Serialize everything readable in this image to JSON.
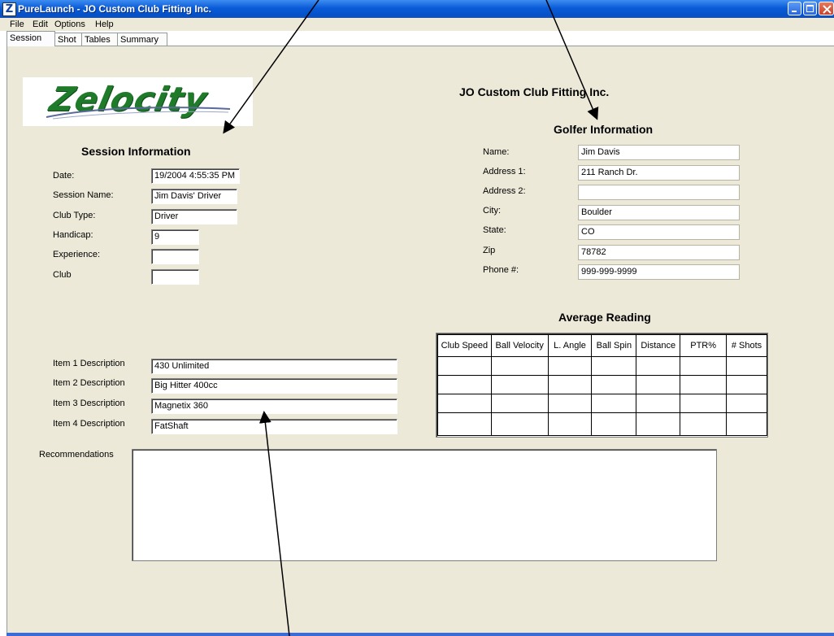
{
  "window": {
    "title": "PureLaunch - JO Custom Club Fitting Inc.",
    "icon_letter": "Z"
  },
  "menu": [
    "File",
    "Edit",
    "Options",
    "Help"
  ],
  "tabs": [
    "Session",
    "Shot",
    "Tables",
    "Summary"
  ],
  "active_tab": "Session",
  "logo_text": "Zelocity",
  "company": "JO Custom Club Fitting Inc.",
  "session": {
    "heading": "Session Information",
    "fields": [
      {
        "label": "Date:",
        "value": "19/2004 4:55:35 PM"
      },
      {
        "label": "Session Name:",
        "value": "Jim Davis' Driver"
      },
      {
        "label": "Club Type:",
        "value": "Driver"
      },
      {
        "label": "Handicap:",
        "value": "9"
      },
      {
        "label": "Experience:",
        "value": ""
      },
      {
        "label": "Club",
        "value": ""
      }
    ]
  },
  "golfer": {
    "heading": "Golfer Information",
    "fields": [
      {
        "label": "Name:",
        "value": "Jim Davis"
      },
      {
        "label": "Address 1:",
        "value": "211 Ranch Dr."
      },
      {
        "label": "Address 2:",
        "value": ""
      },
      {
        "label": "City:",
        "value": "Boulder"
      },
      {
        "label": "State:",
        "value": "CO"
      },
      {
        "label": "Zip",
        "value": "78782"
      },
      {
        "label": "Phone #:",
        "value": "999-999-9999"
      }
    ]
  },
  "average": {
    "heading": "Average Reading",
    "columns": [
      "Club Speed",
      "Ball Velocity",
      "L. Angle",
      "Ball Spin",
      "Distance",
      "PTR%",
      "# Shots"
    ],
    "rows": 4
  },
  "items": [
    {
      "label": "Item 1 Description",
      "value": "430 Unlimited"
    },
    {
      "label": "Item 2 Description",
      "value": "Big Hitter 400cc"
    },
    {
      "label": "Item 3 Description",
      "value": "Magnetix 360"
    },
    {
      "label": "Item 4 Description",
      "value": "FatShaft"
    }
  ],
  "recommendations": {
    "label": "Recommendations",
    "value": ""
  }
}
